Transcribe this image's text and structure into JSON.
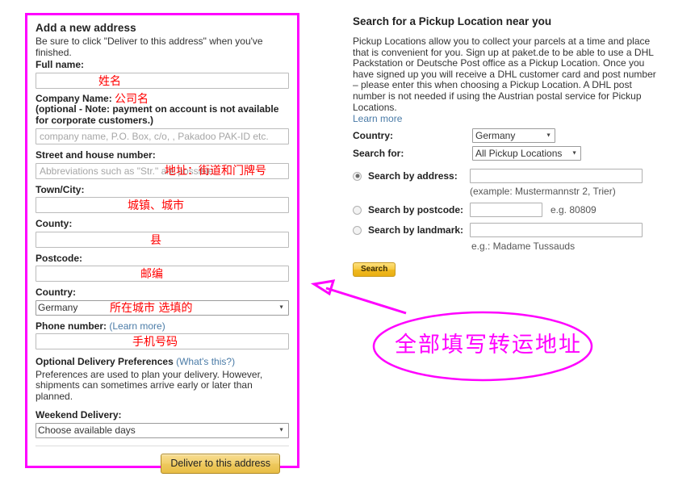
{
  "address_form": {
    "title": "Add a new address",
    "intro": "Be sure to click \"Deliver to this address\" when you've finished.",
    "fields": {
      "full_name_label": "Full name:",
      "full_name_value": "",
      "full_name_annotation": "姓名",
      "company_label": "Company Name:",
      "company_annotation": "公司名",
      "company_note_line1": "(optional - Note: payment on account is not available",
      "company_note_line2": "for corporate customers.)",
      "company_placeholder": "company name, P.O. Box, c/o, , Pakadoo PAK-ID etc.",
      "company_value": "",
      "street_label": "Street and house number:",
      "street_placeholder": "Abbreviations such as \"Str.\" are possible.",
      "street_value": "",
      "street_annotation": "地址：街道和门牌号",
      "town_label": "Town/City:",
      "town_value": "",
      "town_annotation": "城镇、城市",
      "county_label": "County:",
      "county_value": "",
      "county_annotation": "县",
      "postcode_label": "Postcode:",
      "postcode_value": "",
      "postcode_annotation": "邮编",
      "country_label": "Country:",
      "country_value": "Germany",
      "country_annotation": "所在城市 选填的",
      "phone_label": "Phone number:",
      "phone_learn_more": "(Learn more)",
      "phone_value": "",
      "phone_annotation": "手机号码",
      "prefs_label": "Optional Delivery Preferences",
      "prefs_whats_this": "(What's this?)",
      "prefs_note": "Preferences are used to plan your delivery. However, shipments can sometimes arrive early or later than planned.",
      "weekend_label": "Weekend Delivery:",
      "weekend_value": "Choose available days"
    },
    "submit_button": "Deliver to this address"
  },
  "pickup_panel": {
    "title": "Search for a Pickup Location near you",
    "body": "Pickup Locations allow you to collect your parcels at a time and place that is convenient for you. Sign up at paket.de to be able to use a DHL Packstation or Deutsche Post office as a Pickup Location. Once you have signed up you will receive a DHL customer card and post number – please enter this when choosing a Pickup Location. A DHL post number is not needed if using the Austrian postal service for Pickup Locations.",
    "learn_more": "Learn more",
    "country_label": "Country:",
    "country_value": "Germany",
    "search_for_label": "Search for:",
    "search_for_value": "All Pickup Locations",
    "by_address_label": "Search by address:",
    "by_address_value": "",
    "by_address_hint": "(example: Mustermannstr 2, Trier)",
    "by_postcode_label": "Search by postcode:",
    "by_postcode_value": "",
    "by_postcode_hint": "e.g. 80809",
    "by_landmark_label": "Search by landmark:",
    "by_landmark_value": "",
    "by_landmark_hint": "e.g.: Madame Tussauds",
    "search_button": "Search"
  },
  "annotation": {
    "callout_text": "全部填写转运地址",
    "color": "#ff00ff",
    "field_note_color": "#ff0000"
  }
}
